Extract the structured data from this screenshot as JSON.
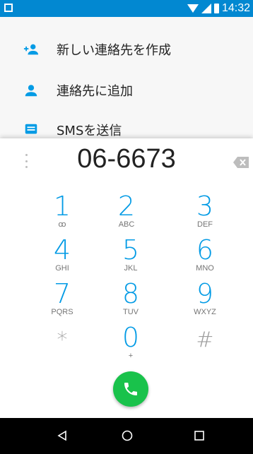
{
  "status_bar": {
    "time": "14:32",
    "background_color": "#0288D1",
    "icons": [
      "notification-icon",
      "wifi-icon",
      "signal-icon",
      "battery-icon"
    ]
  },
  "options": [
    {
      "icon": "add-contact-icon",
      "label": "新しい連絡先を作成"
    },
    {
      "icon": "person-icon",
      "label": "連絡先に追加"
    },
    {
      "icon": "sms-icon",
      "label": "SMSを送信"
    }
  ],
  "dialer": {
    "number": "06-6673",
    "overflow_icon": "more-vertical-icon",
    "backspace_icon": "backspace-icon",
    "accent_color": "#039BE5",
    "call_button_color": "#19C24B",
    "keys": [
      {
        "digit": "1",
        "letters": "ꝏ"
      },
      {
        "digit": "2",
        "letters": "ABC"
      },
      {
        "digit": "3",
        "letters": "DEF"
      },
      {
        "digit": "4",
        "letters": "GHI"
      },
      {
        "digit": "5",
        "letters": "JKL"
      },
      {
        "digit": "6",
        "letters": "MNO"
      },
      {
        "digit": "7",
        "letters": "PQRS"
      },
      {
        "digit": "8",
        "letters": "TUV"
      },
      {
        "digit": "9",
        "letters": "WXYZ"
      },
      {
        "digit": "*",
        "letters": ""
      },
      {
        "digit": "0",
        "letters": "+"
      },
      {
        "digit": "#",
        "letters": ""
      }
    ]
  },
  "nav_bar": {
    "icons": [
      "back-icon",
      "home-icon",
      "recents-icon"
    ]
  }
}
